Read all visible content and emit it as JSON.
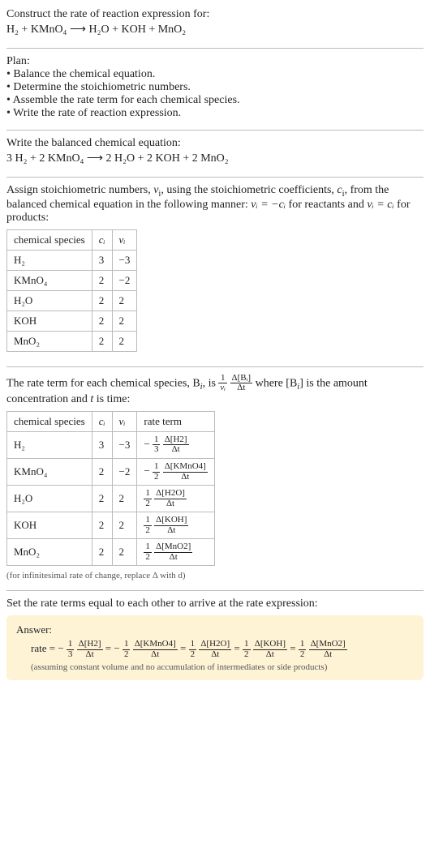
{
  "prompt": {
    "title": "Construct the rate of reaction expression for:",
    "equation": "H₂ + KMnO₄  ⟶  H₂O + KOH + MnO₂"
  },
  "plan": {
    "label": "Plan:",
    "items": [
      "Balance the chemical equation.",
      "Determine the stoichiometric numbers.",
      "Assemble the rate term for each chemical species.",
      "Write the rate of reaction expression."
    ]
  },
  "balanced": {
    "label": "Write the balanced chemical equation:",
    "equation": "3 H₂ + 2 KMnO₄  ⟶  2 H₂O + 2 KOH + 2 MnO₂"
  },
  "assign": {
    "text_before": "Assign stoichiometric numbers, ",
    "nu": "ν",
    "sub_i": "i",
    "text_mid1": ", using the stoichiometric coefficients, ",
    "ci": "c",
    "text_mid2": ", from the balanced chemical equation in the following manner: ",
    "rel1": "νᵢ = −cᵢ",
    "text_mid3": " for reactants and ",
    "rel2": "νᵢ = cᵢ",
    "text_mid4": " for products:"
  },
  "table1": {
    "headers": [
      "chemical species",
      "cᵢ",
      "νᵢ"
    ],
    "rows": [
      [
        "H₂",
        "3",
        "−3"
      ],
      [
        "KMnO₄",
        "2",
        "−2"
      ],
      [
        "H₂O",
        "2",
        "2"
      ],
      [
        "KOH",
        "2",
        "2"
      ],
      [
        "MnO₂",
        "2",
        "2"
      ]
    ]
  },
  "rate_term": {
    "text_before": "The rate term for each chemical species, B",
    "text_mid1": ", is ",
    "frac1_num": "1",
    "frac1_den": "νᵢ",
    "frac2_num": "Δ[Bᵢ]",
    "frac2_den": "Δt",
    "text_mid2": " where [B",
    "text_mid3": "] is the amount concentration and ",
    "t": "t",
    "text_mid4": " is time:"
  },
  "table2": {
    "headers": [
      "chemical species",
      "cᵢ",
      "νᵢ",
      "rate term"
    ],
    "rows": [
      {
        "sp": "H₂",
        "c": "3",
        "v": "−3",
        "sign": "−",
        "coef_num": "1",
        "coef_den": "3",
        "d_num": "Δ[H2]",
        "d_den": "Δt"
      },
      {
        "sp": "KMnO₄",
        "c": "2",
        "v": "−2",
        "sign": "−",
        "coef_num": "1",
        "coef_den": "2",
        "d_num": "Δ[KMnO4]",
        "d_den": "Δt"
      },
      {
        "sp": "H₂O",
        "c": "2",
        "v": "2",
        "sign": "",
        "coef_num": "1",
        "coef_den": "2",
        "d_num": "Δ[H2O]",
        "d_den": "Δt"
      },
      {
        "sp": "KOH",
        "c": "2",
        "v": "2",
        "sign": "",
        "coef_num": "1",
        "coef_den": "2",
        "d_num": "Δ[KOH]",
        "d_den": "Δt"
      },
      {
        "sp": "MnO₂",
        "c": "2",
        "v": "2",
        "sign": "",
        "coef_num": "1",
        "coef_den": "2",
        "d_num": "Δ[MnO2]",
        "d_den": "Δt"
      }
    ]
  },
  "infinitesimal_note": "(for infinitesimal rate of change, replace Δ with d)",
  "set_equal": "Set the rate terms equal to each other to arrive at the rate expression:",
  "answer": {
    "label": "Answer:",
    "rate_prefix": "rate = ",
    "terms": [
      {
        "sign": "−",
        "coef_num": "1",
        "coef_den": "3",
        "d_num": "Δ[H2]",
        "d_den": "Δt"
      },
      {
        "sign": "−",
        "coef_num": "1",
        "coef_den": "2",
        "d_num": "Δ[KMnO4]",
        "d_den": "Δt"
      },
      {
        "sign": "",
        "coef_num": "1",
        "coef_den": "2",
        "d_num": "Δ[H2O]",
        "d_den": "Δt"
      },
      {
        "sign": "",
        "coef_num": "1",
        "coef_den": "2",
        "d_num": "Δ[KOH]",
        "d_den": "Δt"
      },
      {
        "sign": "",
        "coef_num": "1",
        "coef_den": "2",
        "d_num": "Δ[MnO2]",
        "d_den": "Δt"
      }
    ],
    "eq": " = ",
    "assume": "(assuming constant volume and no accumulation of intermediates or side products)"
  }
}
